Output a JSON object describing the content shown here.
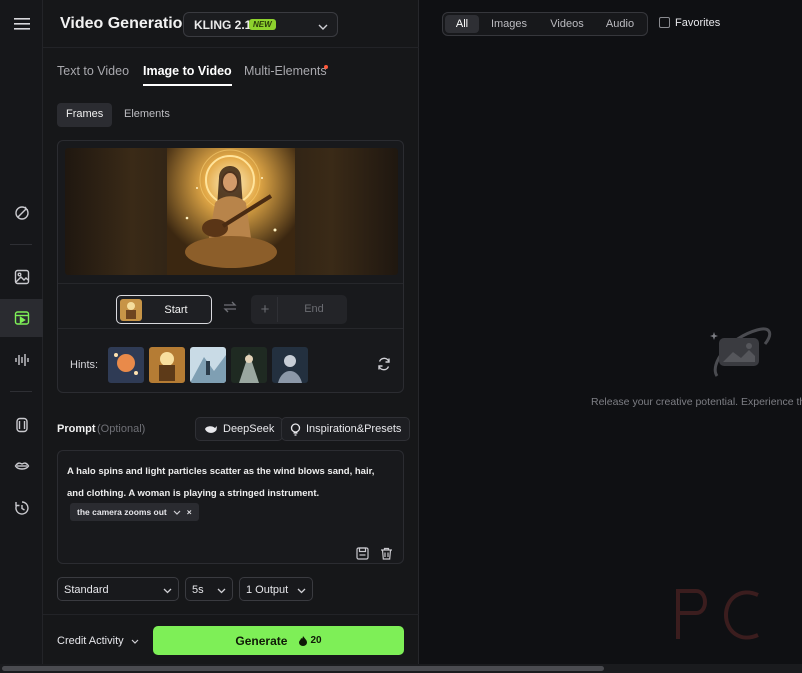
{
  "header": {
    "title": "Video Generation",
    "model_name": "KLING 2.1",
    "model_badge": "NEW"
  },
  "tabs": [
    {
      "label": "Text to Video"
    },
    {
      "label": "Image to Video"
    },
    {
      "label": "Multi-Elements"
    }
  ],
  "subtabs": [
    {
      "label": "Frames"
    },
    {
      "label": "Elements"
    }
  ],
  "frames": {
    "start_label": "Start",
    "end_label": "End",
    "end_plus": "+",
    "hints_label": "Hints:"
  },
  "prompt": {
    "label": "Prompt",
    "optional": "(Optional)",
    "deepseek_label": "DeepSeek",
    "inspiration_label": "Inspiration&Presets",
    "text": "A halo spins and light particles scatter as the wind blows sand, hair, and clothing. A woman is playing a stringed instrument.",
    "camera_chip": "the camera zooms out",
    "chip_close": "×"
  },
  "settings": {
    "mode": "Standard",
    "duration": "5s",
    "outputs": "1 Output"
  },
  "footer": {
    "credit_label": "Credit Activity",
    "generate_label": "Generate",
    "generate_cost": "20"
  },
  "right": {
    "filters": [
      {
        "label": "All"
      },
      {
        "label": "Images"
      },
      {
        "label": "Videos"
      },
      {
        "label": "Audio"
      }
    ],
    "favorites_label": "Favorites",
    "empty_text": "Release your creative potential. Experience th"
  },
  "colors": {
    "accent_green": "#7eef57",
    "badge_green": "#8dd12d",
    "notification_red": "#ff5a3c"
  }
}
